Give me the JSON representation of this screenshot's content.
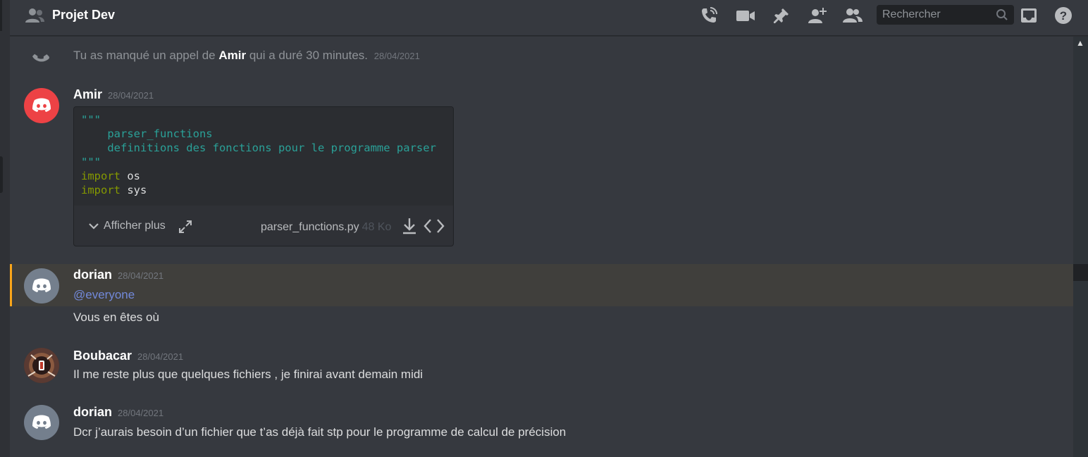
{
  "header": {
    "title": "Projet Dev",
    "search_placeholder": "Rechercher"
  },
  "system_call": {
    "prefix": "Tu as manqué un appel de ",
    "caller": "Amir",
    "suffix": " qui a duré 30 minutes.",
    "timestamp": "28/04/2021"
  },
  "messages": [
    {
      "author": "Amir",
      "timestamp": "28/04/2021",
      "avatar_color": "#ed4245",
      "attachment": {
        "code_lines": [
          "\"\"\"",
          "    parser_functions",
          "    definitions des fonctions pour le programme parser",
          "\"\"\"",
          "import os",
          "import sys"
        ],
        "expand_label": "Afficher plus",
        "filename": "parser_functions.py",
        "filesize": "48 Ko"
      }
    },
    {
      "author": "dorian",
      "timestamp": "28/04/2021",
      "avatar_color": "#747f8d",
      "mention": "@everyone",
      "followup": "Vous en êtes où"
    },
    {
      "author": "Boubacar",
      "timestamp": "28/04/2021",
      "text": "Il me reste plus que quelques fichiers , je finirai avant demain midi"
    },
    {
      "author": "dorian",
      "timestamp": "28/04/2021",
      "avatar_color": "#747f8d",
      "text": "Dcr j’aurais besoin d’un fichier que t’as déjà fait stp pour le programme de calcul de précision"
    }
  ],
  "icons": [
    "people-icon",
    "phone-call-icon",
    "video-icon",
    "pin-icon",
    "add-member-icon",
    "member-list-icon",
    "search-icon",
    "inbox-icon",
    "help-icon"
  ],
  "colors": {
    "background": "#36393f",
    "mention_highlight": "#faa61a",
    "mention_text": "#7289da",
    "code_doc": "#2aa198",
    "code_keyword": "#859900"
  }
}
